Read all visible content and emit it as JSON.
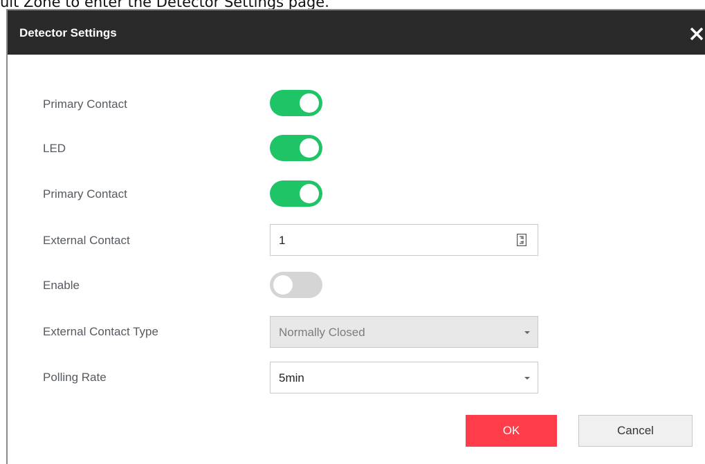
{
  "caption": "ult Zone to enter the Detector Settings page.",
  "dialog": {
    "title": "Detector Settings",
    "close_label": "✕"
  },
  "rows": [
    {
      "label": "Primary Contact",
      "control": "toggle",
      "state": "on"
    },
    {
      "label": "LED",
      "control": "toggle",
      "state": "on"
    },
    {
      "label": "Primary Contact",
      "control": "toggle",
      "state": "on"
    },
    {
      "label": "External Contact",
      "control": "number",
      "value": "1"
    },
    {
      "label": "Enable",
      "control": "toggle",
      "state": "off"
    },
    {
      "label": "External Contact Type",
      "control": "select",
      "value": "Normally Closed",
      "disabled": true
    },
    {
      "label": "Polling Rate",
      "control": "select",
      "value": "5min",
      "disabled": false
    }
  ],
  "buttons": {
    "ok": "OK",
    "cancel": "Cancel"
  },
  "colors": {
    "toggle_on": "#1fc467",
    "toggle_off": "#d5d5d5",
    "ok_button": "#ff3c4a",
    "titlebar": "#2a2a2a"
  }
}
